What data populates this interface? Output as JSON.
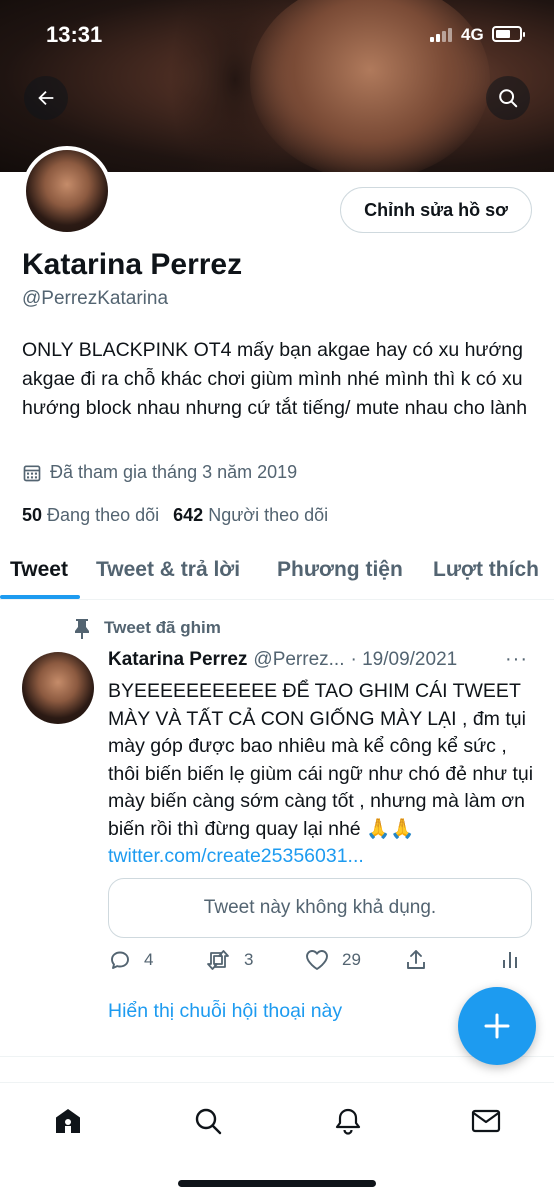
{
  "status_bar": {
    "time": "13:31",
    "network": "4G",
    "battery_level": 0.5
  },
  "header": {
    "back_icon": "arrow-left-icon",
    "search_icon": "search-icon"
  },
  "profile": {
    "edit_button": "Chỉnh sửa hồ sơ",
    "name": "Katarina Perrez",
    "handle": "@PerrezKatarina",
    "bio": "ONLY BLACKPINK OT4 mấy bạn akgae hay có xu hướng akgae đi ra chỗ khác chơi giùm mình nhé mình thì k có xu hướng block nhau nhưng cứ tắt tiếng/ mute nhau cho lành",
    "joined": "Đã tham gia tháng 3 năm 2019",
    "following_count": "50",
    "following_label": "Đang theo dõi",
    "followers_count": "642",
    "followers_label": "Người theo dõi"
  },
  "tabs": [
    {
      "label": "Tweet"
    },
    {
      "label": "Tweet & trả lời"
    },
    {
      "label": "Phương tiện"
    },
    {
      "label": "Lượt thích"
    }
  ],
  "pinned_tweet": {
    "pinned_label": "Tweet đã ghim",
    "author_name": "Katarina Perrez",
    "author_handle": "@Perrez...",
    "date": "· 19/09/2021",
    "more": "···",
    "text": "BYEEEEEEEEEEE ĐỂ TAO GHIM CÁI TWEET MÀY VÀ TẤT CẢ CON GIỐNG MÀY LẠI , đm tụi mày góp được bao nhiêu mà kể công kể sức , thôi biến biến lẹ giùm cái ngữ như chó đẻ như tụi mày biến càng sớm càng tốt , nhưng mà làm ơn biến rồi thì đừng quay lại nhé 🙏🙏",
    "link": "twitter.com/create25356031...",
    "unavailable": "Tweet này không khả dụng.",
    "replies": "4",
    "retweets": "3",
    "likes": "29",
    "show_thread": "Hiển thị chuỗi hội thoại này"
  },
  "colors": {
    "accent": "#1d9bf0",
    "text": "#0f1419",
    "secondary": "#536471",
    "border": "#cfd9de"
  },
  "bottom_nav": [
    "home-icon",
    "search-icon",
    "bell-icon",
    "mail-icon"
  ]
}
